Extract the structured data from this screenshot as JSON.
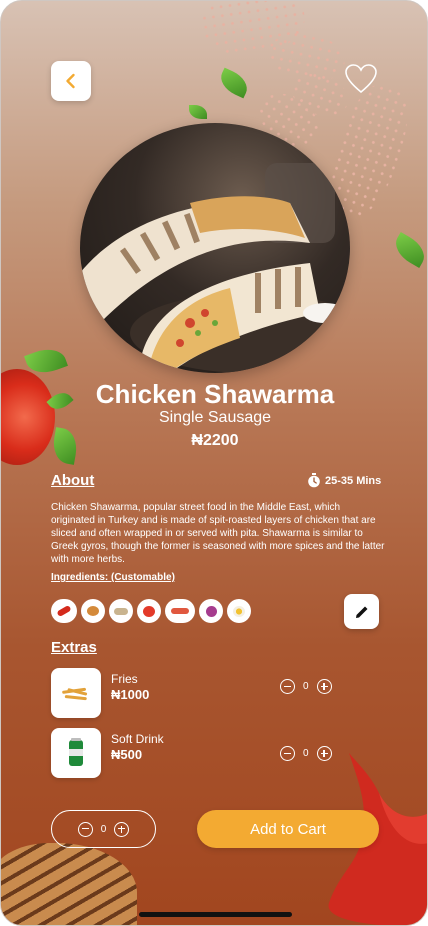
{
  "product": {
    "name": "Chicken Shawarma",
    "variant": "Single Sausage",
    "price": "₦2200"
  },
  "about": {
    "label": "About",
    "time": "25-35 Mins",
    "description": "Chicken Shawarma, popular street food in the Middle East, which originated in Turkey and is made of spit-roasted layers of chicken that are sliced and often wrapped in or served with pita. Shawarma is similar to Greek gyros, though the former is seasoned with more spices and the latter with more herbs."
  },
  "ingredients": {
    "label": "Ingredients: (Customable)",
    "items": [
      "chili-pepper",
      "chicken",
      "rice",
      "tomato",
      "sausage",
      "onion",
      "egg"
    ]
  },
  "extras": {
    "label": "Extras",
    "items": [
      {
        "name": "Fries",
        "price": "₦1000",
        "quantity": "0"
      },
      {
        "name": "Soft Drink",
        "price": "₦500",
        "quantity": "0"
      }
    ]
  },
  "footer": {
    "quantity": "0",
    "add_to_cart_label": "Add to Cart"
  },
  "icons": {
    "back": "chevron-left-icon",
    "favorite": "heart-icon",
    "timer": "stopwatch-icon",
    "edit": "pencil-icon"
  },
  "colors": {
    "accent": "#f3aa32",
    "back_chevron": "#f3aa32"
  }
}
